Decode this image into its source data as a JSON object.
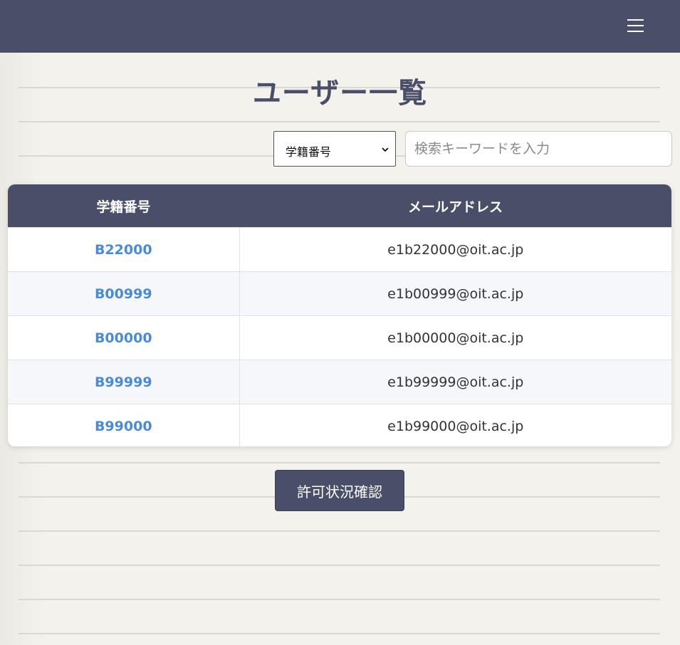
{
  "header": {
    "menu_icon": "hamburger-menu-icon",
    "bar_color": "#4a4e69"
  },
  "page": {
    "title": "ユーザー一覧"
  },
  "search": {
    "field_selected": "学籍番号",
    "placeholder": "検索キーワードを入力",
    "value": ""
  },
  "table": {
    "headers": [
      "学籍番号",
      "メールアドレス"
    ],
    "rows": [
      {
        "id": "B22000",
        "email": "e1b22000@oit.ac.jp"
      },
      {
        "id": "B00999",
        "email": "e1b00999@oit.ac.jp"
      },
      {
        "id": "B00000",
        "email": "e1b00000@oit.ac.jp"
      },
      {
        "id": "B99999",
        "email": "e1b99999@oit.ac.jp"
      },
      {
        "id": "B99000",
        "email": "e1b99000@oit.ac.jp"
      }
    ]
  },
  "actions": {
    "confirm_label": "許可状況確認"
  },
  "colors": {
    "primary": "#4a4e69",
    "link": "#4a8bd4",
    "background": "#f3f2ec"
  }
}
